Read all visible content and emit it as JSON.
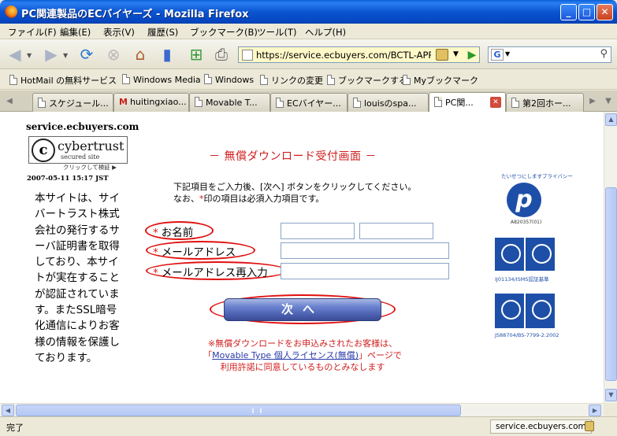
{
  "window": {
    "title": "PC関連製品のECバイヤーズ - Mozilla Firefox",
    "minimize": "_",
    "maximize": "□",
    "close": "✕"
  },
  "menu": [
    "ファイル(F)",
    "編集(E)",
    "表示(V)",
    "履歴(S)",
    "ブックマーク(B)",
    "ツール(T)",
    "ヘルプ(H)"
  ],
  "nav": {
    "url": "https://service.ecbuyers.com/BCTL-APP/a",
    "search_value": ""
  },
  "bookmarks": [
    "HotMail の無料サービス",
    "Windows Media",
    "Windows",
    "リンクの変更",
    "ブックマークする",
    "Myブックマーク"
  ],
  "tabs": [
    {
      "label": "スケジュール..."
    },
    {
      "label": "huitingxiao..."
    },
    {
      "label": "Movable T..."
    },
    {
      "label": "ECバイヤー..."
    },
    {
      "label": "louisのspa..."
    },
    {
      "label": "PC関..."
    },
    {
      "label": "第2回ホー..."
    }
  ],
  "sidebar": {
    "host": "service.ecbuyers.com",
    "cybertrust_c": "c",
    "cybertrust_name": "cybertrust",
    "cybertrust_sub": "secured site",
    "cybertrust_click": "クリックして検証 ▶",
    "timestamp": "2007-05-11  15:17  JST",
    "description": "本サイトは、サイバートラスト株式会社の発行するサーバ証明書を取得しており、本サイトが実在することが認証されています。またSSL暗号化通信によりお客様の情報を保護しております。"
  },
  "form": {
    "title": "－ 無償ダウンロード受付画面 －",
    "instruction_line1": "下記項目をご入力後、[次へ] ボタンをクリックしてください。",
    "instruction_line2_a": "なお、",
    "instruction_line2_star": "*",
    "instruction_line2_b": "印の項目は必須入力項目です。",
    "star": "*",
    "name_label": "お名前",
    "email_label": "メールアドレス",
    "email_confirm_label": "メールアドレス再入力",
    "last_name_value": "",
    "first_name_value": "",
    "email_value": "",
    "email_confirm_value": "",
    "next_button": "次へ"
  },
  "notice": {
    "line1": "※無償ダウンロードをお申込みされたお客様は、",
    "line2_prefix": "「",
    "link_text": "Movable Type 個人ライセンス(無償)",
    "line2_suffix": "」ページで",
    "line3": "利用許諾に同意しているものとみなします"
  },
  "badges": {
    "privacy_arc": "たいせつにしますプライバシー",
    "privacy_letter": "p",
    "privacy_num": "A820357(01)",
    "isms_caption": "IJ01134/ISMS認証基準",
    "bs_caption": "JS88704/BS-7799-2:2002"
  },
  "status": {
    "text": "完了",
    "host": "service.ecbuyers.com"
  },
  "colors": {
    "accent_red": "#d01e1e",
    "titlebar_blue": "#0b55d2",
    "button_blue": "#4a5fb0"
  }
}
